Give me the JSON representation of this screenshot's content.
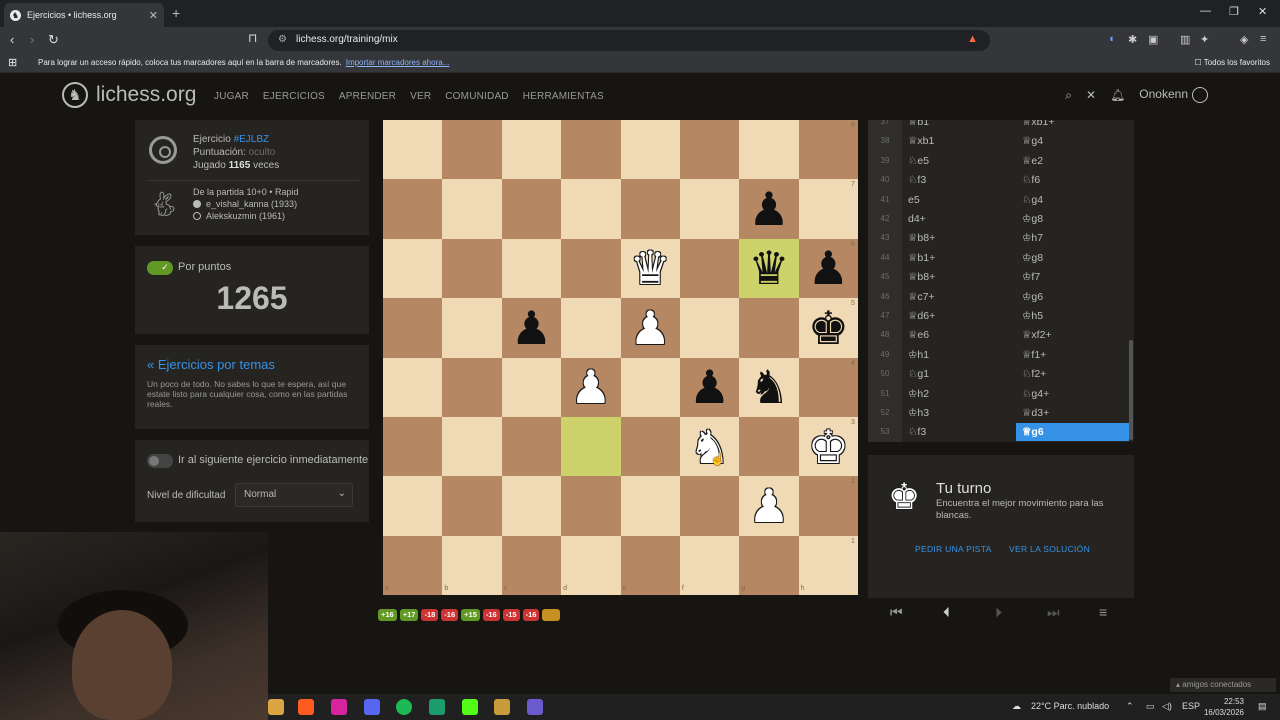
{
  "browser": {
    "tab_title": "Ejercicios • lichess.org",
    "new_tab": "+",
    "url": "lichess.org/training/mix",
    "bookmark_bar_text": "Para lograr un acceso rápido, coloca tus marcadores aquí en la barra de marcadores.",
    "bookmark_bar_link": "Importar marcadores ahora...",
    "favorites": "Todos los favoritos"
  },
  "header": {
    "logo": "lichess.org",
    "menu": [
      "JUGAR",
      "EJERCICIOS",
      "APRENDER",
      "VER",
      "COMUNIDAD",
      "HERRAMIENTAS"
    ],
    "username": "Onokenn"
  },
  "puzzle_info": {
    "label": "Ejercicio",
    "id": "#EJLBZ",
    "rating_label": "Puntuación:",
    "rating_value": "oculto",
    "played_prefix": "Jugado",
    "played_count": "1165",
    "played_suffix": "veces",
    "game_line": "De la partida 10+0 • Rapid",
    "white_player": "e_vishal_kanna (1933)",
    "black_player": "Alekskuzmin (1961)"
  },
  "score_panel": {
    "label": "Por puntos",
    "value": "1265"
  },
  "themes": {
    "link": "« Ejercicios por temas",
    "desc": "Un poco de todo. No sabes lo que te espera, así que estate listo para cualquier cosa, como en las partidas reales."
  },
  "settings": {
    "auto_next": "Ir al siguiente ejercicio inmediatamente",
    "difficulty_label": "Nivel de dificultad",
    "difficulty_value": "Normal"
  },
  "board": {
    "files": [
      "a",
      "b",
      "c",
      "d",
      "e",
      "f",
      "g",
      "h"
    ],
    "ranks": [
      "8",
      "7",
      "6",
      "5",
      "4",
      "3",
      "2",
      "1"
    ],
    "highlights": [
      "g6",
      "d3"
    ],
    "pieces": [
      {
        "sq": "g7",
        "p": "bp",
        "g": "♟"
      },
      {
        "sq": "e6",
        "p": "wp",
        "g": "♛"
      },
      {
        "sq": "g6",
        "p": "bp",
        "g": "♛"
      },
      {
        "sq": "h6",
        "p": "bp",
        "g": "♟"
      },
      {
        "sq": "c5",
        "p": "bp",
        "g": "♟"
      },
      {
        "sq": "e5",
        "p": "wp",
        "g": "♟"
      },
      {
        "sq": "h5",
        "p": "bp",
        "g": "♚"
      },
      {
        "sq": "d4",
        "p": "wp",
        "g": "♟"
      },
      {
        "sq": "f4",
        "p": "bp",
        "g": "♟"
      },
      {
        "sq": "g4",
        "p": "bp",
        "g": "♞"
      },
      {
        "sq": "f3",
        "p": "wp",
        "g": "♞"
      },
      {
        "sq": "h3",
        "p": "wp",
        "g": "♚"
      },
      {
        "sq": "g2",
        "p": "wp",
        "g": "♟"
      }
    ]
  },
  "moves": [
    {
      "n": "37",
      "w": "♕b1",
      "b": "♕xb1+"
    },
    {
      "n": "38",
      "w": "♕xb1",
      "b": "♕g4"
    },
    {
      "n": "39",
      "w": "♘e5",
      "b": "♕e2"
    },
    {
      "n": "40",
      "w": "♘f3",
      "b": "♘f6"
    },
    {
      "n": "41",
      "w": "e5",
      "b": "♘g4"
    },
    {
      "n": "42",
      "w": "d4+",
      "b": "♔g8"
    },
    {
      "n": "43",
      "w": "♕b8+",
      "b": "♔h7"
    },
    {
      "n": "44",
      "w": "♕b1+",
      "b": "♔g8"
    },
    {
      "n": "45",
      "w": "♕b8+",
      "b": "♔f7"
    },
    {
      "n": "46",
      "w": "♕c7+",
      "b": "♔g6"
    },
    {
      "n": "47",
      "w": "♕d6+",
      "b": "♔h5"
    },
    {
      "n": "48",
      "w": "♕e6",
      "b": "♕xf2+"
    },
    {
      "n": "49",
      "w": "♔h1",
      "b": "♕f1+"
    },
    {
      "n": "50",
      "w": "♘g1",
      "b": "♘f2+"
    },
    {
      "n": "51",
      "w": "♔h2",
      "b": "♘g4+"
    },
    {
      "n": "52",
      "w": "♔h3",
      "b": "♕d3+"
    },
    {
      "n": "53",
      "w": "♘f3",
      "b": "♕g6"
    }
  ],
  "turn": {
    "title": "Tu turno",
    "desc": "Encuentra el mejor movimiento para las blancas.",
    "hint": "PEDIR UNA PISTA",
    "solution": "VER LA SOLUCIÓN"
  },
  "chips": [
    {
      "v": "+16",
      "t": "good"
    },
    {
      "v": "+17",
      "t": "good"
    },
    {
      "v": "-18",
      "t": "bad"
    },
    {
      "v": "-16",
      "t": "bad"
    },
    {
      "v": "+15",
      "t": "good"
    },
    {
      "v": "-16",
      "t": "bad"
    },
    {
      "v": "-15",
      "t": "bad"
    },
    {
      "v": "-16",
      "t": "bad"
    },
    {
      "v": "",
      "t": "pend"
    }
  ],
  "taskbar": {
    "weather": "22°C Parc. nublado",
    "lang": "ESP",
    "time": "22:53",
    "date": "16/03/2026",
    "friends": "amigos conectados"
  }
}
